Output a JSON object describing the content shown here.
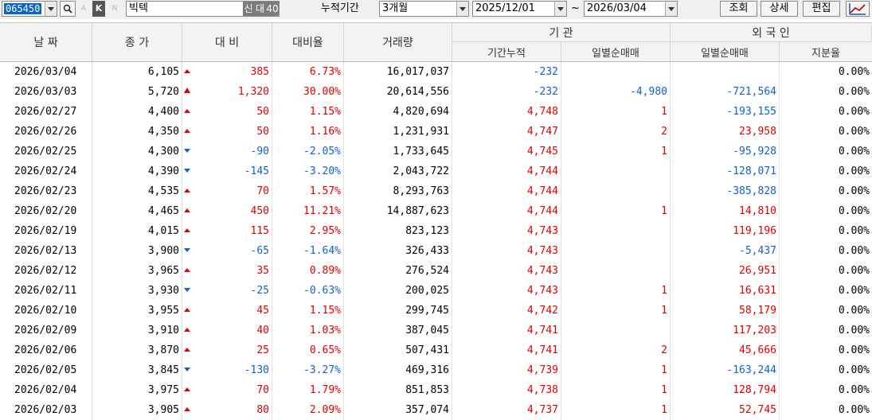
{
  "toolbar": {
    "code": "065450",
    "letter_a": "A",
    "letter_k": "K",
    "letter_n": "N",
    "stock_name": "빅텍",
    "badge_new": "신",
    "badge_big": "대",
    "badge_count": "40",
    "period_label": "누적기간",
    "period_value": "3개월",
    "date_from": "2025/12/01",
    "tilde": "~",
    "date_to": "2026/03/04",
    "query_button": "조회",
    "detail_button": "상세",
    "edit_button": "편집"
  },
  "headers": {
    "date": "날 짜",
    "close": "종 가",
    "change": "대 비",
    "change_rate": "대비율",
    "volume": "거래량",
    "institution": "기 관",
    "inst_cum": "기간누적",
    "inst_daily": "일별순매매",
    "foreign": "외 국 인",
    "for_daily": "일별순매매",
    "for_share": "지분율"
  },
  "colors": {
    "up": "#e00000",
    "down": "#1060d0",
    "selection": "#0a64d0"
  },
  "rows": [
    {
      "date": "2026/03/04",
      "close": "6,105",
      "dir": "up",
      "change": "385",
      "rate": "6.73%",
      "volume": "16,017,037",
      "inst_cum": "-232",
      "inst_daily": "",
      "for_daily": "",
      "for_share": "0.00%"
    },
    {
      "date": "2026/03/03",
      "close": "5,720",
      "dir": "upper",
      "change": "1,320",
      "rate": "30.00%",
      "volume": "20,614,556",
      "inst_cum": "-232",
      "inst_daily": "-4,980",
      "for_daily": "-721,564",
      "for_share": "0.00%"
    },
    {
      "date": "2026/02/27",
      "close": "4,400",
      "dir": "up",
      "change": "50",
      "rate": "1.15%",
      "volume": "4,820,694",
      "inst_cum": "4,748",
      "inst_daily": "1",
      "for_daily": "-193,155",
      "for_share": "0.00%"
    },
    {
      "date": "2026/02/26",
      "close": "4,350",
      "dir": "up",
      "change": "50",
      "rate": "1.16%",
      "volume": "1,231,931",
      "inst_cum": "4,747",
      "inst_daily": "2",
      "for_daily": "23,958",
      "for_share": "0.00%"
    },
    {
      "date": "2026/02/25",
      "close": "4,300",
      "dir": "down",
      "change": "-90",
      "rate": "-2.05%",
      "volume": "1,733,645",
      "inst_cum": "4,745",
      "inst_daily": "1",
      "for_daily": "-95,928",
      "for_share": "0.00%"
    },
    {
      "date": "2026/02/24",
      "close": "4,390",
      "dir": "down",
      "change": "-145",
      "rate": "-3.20%",
      "volume": "2,043,722",
      "inst_cum": "4,744",
      "inst_daily": "",
      "for_daily": "-128,071",
      "for_share": "0.00%"
    },
    {
      "date": "2026/02/23",
      "close": "4,535",
      "dir": "up",
      "change": "70",
      "rate": "1.57%",
      "volume": "8,293,763",
      "inst_cum": "4,744",
      "inst_daily": "",
      "for_daily": "-385,828",
      "for_share": "0.00%"
    },
    {
      "date": "2026/02/20",
      "close": "4,465",
      "dir": "up",
      "change": "450",
      "rate": "11.21%",
      "volume": "14,887,623",
      "inst_cum": "4,744",
      "inst_daily": "1",
      "for_daily": "14,810",
      "for_share": "0.00%"
    },
    {
      "date": "2026/02/19",
      "close": "4,015",
      "dir": "up",
      "change": "115",
      "rate": "2.95%",
      "volume": "823,123",
      "inst_cum": "4,743",
      "inst_daily": "",
      "for_daily": "119,196",
      "for_share": "0.00%"
    },
    {
      "date": "2026/02/13",
      "close": "3,900",
      "dir": "down",
      "change": "-65",
      "rate": "-1.64%",
      "volume": "326,433",
      "inst_cum": "4,743",
      "inst_daily": "",
      "for_daily": "-5,437",
      "for_share": "0.00%"
    },
    {
      "date": "2026/02/12",
      "close": "3,965",
      "dir": "up",
      "change": "35",
      "rate": "0.89%",
      "volume": "276,524",
      "inst_cum": "4,743",
      "inst_daily": "",
      "for_daily": "26,951",
      "for_share": "0.00%"
    },
    {
      "date": "2026/02/11",
      "close": "3,930",
      "dir": "down",
      "change": "-25",
      "rate": "-0.63%",
      "volume": "200,025",
      "inst_cum": "4,743",
      "inst_daily": "1",
      "for_daily": "16,631",
      "for_share": "0.00%"
    },
    {
      "date": "2026/02/10",
      "close": "3,955",
      "dir": "up",
      "change": "45",
      "rate": "1.15%",
      "volume": "299,745",
      "inst_cum": "4,742",
      "inst_daily": "1",
      "for_daily": "58,179",
      "for_share": "0.00%"
    },
    {
      "date": "2026/02/09",
      "close": "3,910",
      "dir": "up",
      "change": "40",
      "rate": "1.03%",
      "volume": "387,045",
      "inst_cum": "4,741",
      "inst_daily": "",
      "for_daily": "117,203",
      "for_share": "0.00%"
    },
    {
      "date": "2026/02/06",
      "close": "3,870",
      "dir": "up",
      "change": "25",
      "rate": "0.65%",
      "volume": "507,431",
      "inst_cum": "4,741",
      "inst_daily": "2",
      "for_daily": "45,666",
      "for_share": "0.00%"
    },
    {
      "date": "2026/02/05",
      "close": "3,845",
      "dir": "down",
      "change": "-130",
      "rate": "-3.27%",
      "volume": "469,316",
      "inst_cum": "4,739",
      "inst_daily": "1",
      "for_daily": "-163,244",
      "for_share": "0.00%"
    },
    {
      "date": "2026/02/04",
      "close": "3,975",
      "dir": "up",
      "change": "70",
      "rate": "1.79%",
      "volume": "851,853",
      "inst_cum": "4,738",
      "inst_daily": "1",
      "for_daily": "128,794",
      "for_share": "0.00%"
    },
    {
      "date": "2026/02/03",
      "close": "3,905",
      "dir": "up",
      "change": "80",
      "rate": "2.09%",
      "volume": "357,074",
      "inst_cum": "4,737",
      "inst_daily": "1",
      "for_daily": "52,745",
      "for_share": "0.00%"
    }
  ]
}
